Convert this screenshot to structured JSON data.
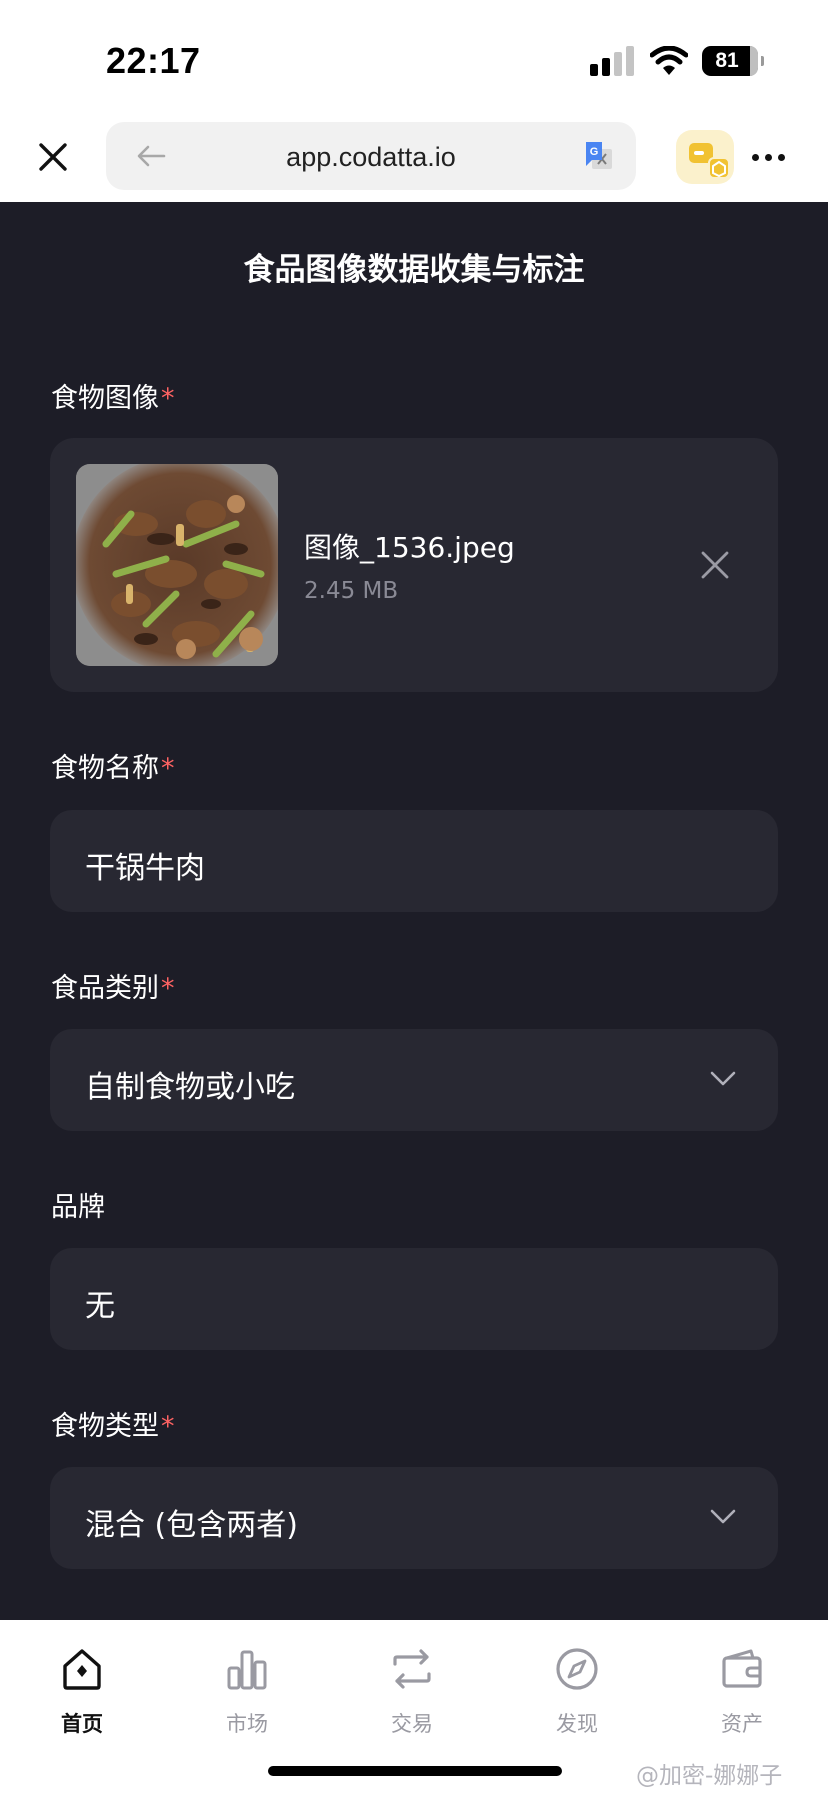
{
  "status_bar": {
    "time": "22:17",
    "battery": "81"
  },
  "browser": {
    "url": "app.codatta.io",
    "icons": [
      "close-icon",
      "back-arrow-icon",
      "translate-icon",
      "wallet-icon",
      "more-icon"
    ]
  },
  "form": {
    "title": "食品图像数据收集与标注",
    "image_field": {
      "label": "食物图像",
      "required_mark": "*",
      "file_name": "图像_1536.jpeg",
      "file_size": "2.45 MB"
    },
    "name_field": {
      "label": "食物名称",
      "required_mark": "*",
      "value": "干锅牛肉"
    },
    "category_field": {
      "label": "食品类别",
      "required_mark": "*",
      "value": "自制食物或小吃"
    },
    "brand_field": {
      "label": "品牌",
      "value": "无"
    },
    "type_field": {
      "label": "食物类型",
      "required_mark": "*",
      "value": "混合 (包含两者)"
    }
  },
  "tabbar": {
    "tabs": [
      {
        "label": "首页",
        "icon": "home-icon",
        "active": true
      },
      {
        "label": "市场",
        "icon": "market-chart-icon",
        "active": false
      },
      {
        "label": "交易",
        "icon": "swap-icon",
        "active": false
      },
      {
        "label": "发现",
        "icon": "compass-icon",
        "active": false
      },
      {
        "label": "资产",
        "icon": "wallet-icon",
        "active": false
      }
    ],
    "watermark": "@加密-娜娜子"
  },
  "colors": {
    "page_bg": "#1d1d27",
    "field_bg": "#282832",
    "required": "#ff6363",
    "muted_text": "#8a8a95"
  }
}
